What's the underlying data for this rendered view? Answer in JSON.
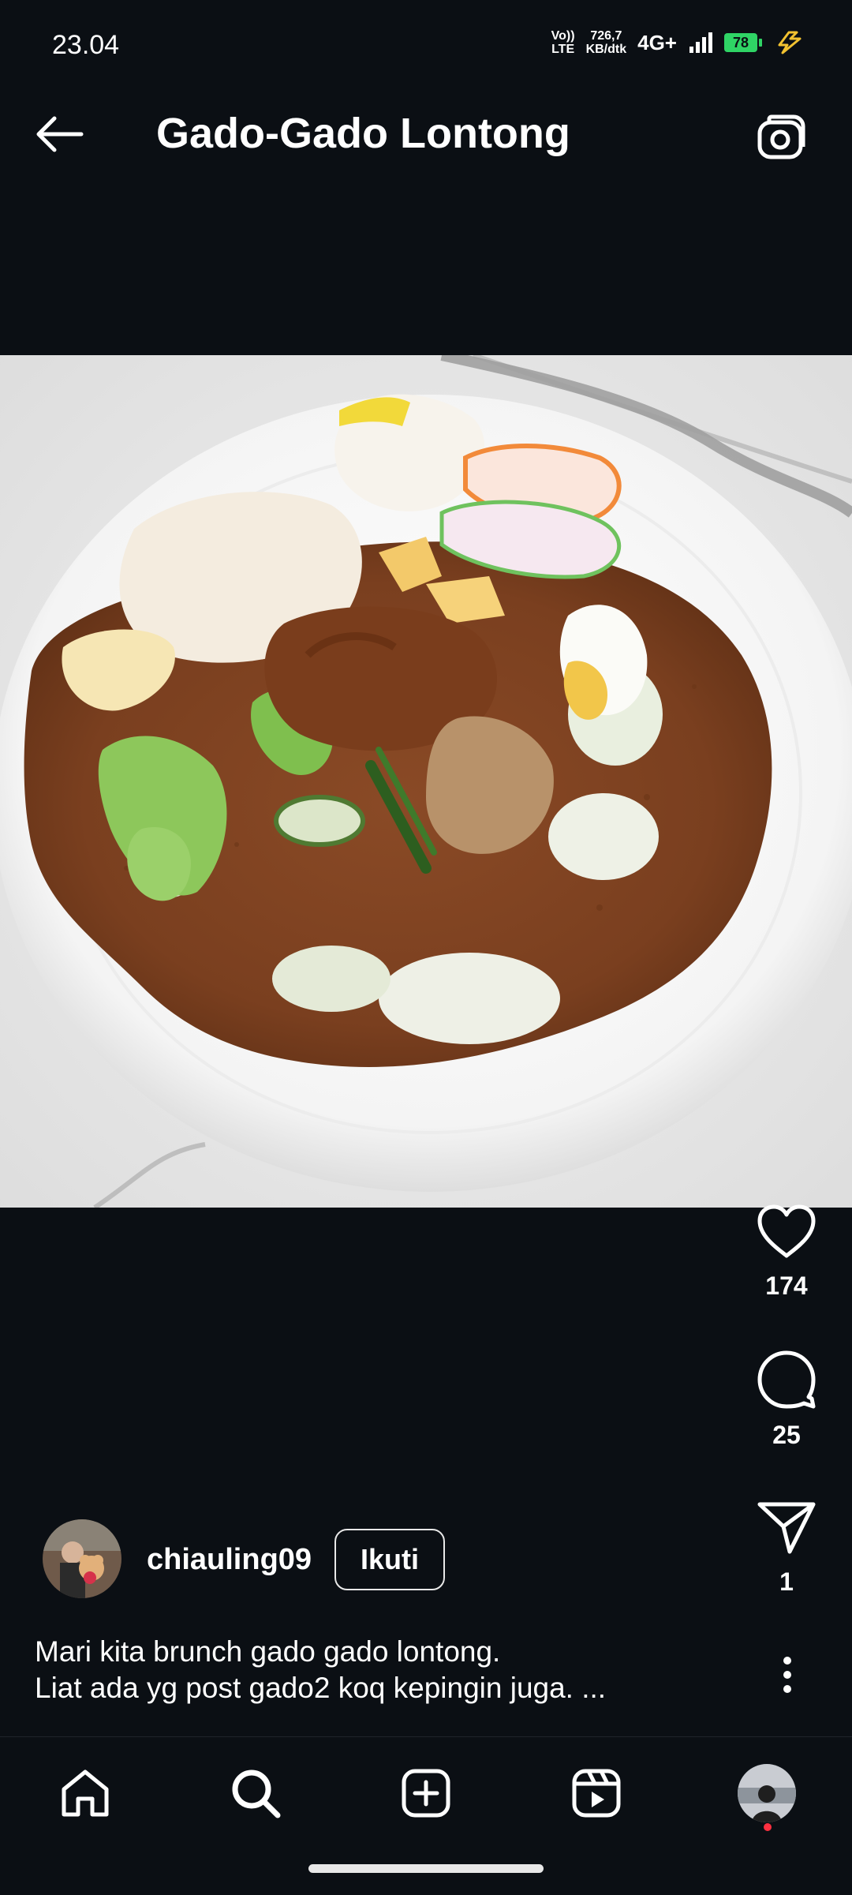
{
  "status_bar": {
    "time": "23.04",
    "volte_line1": "Vo))",
    "volte_line2": "LTE",
    "speed_value": "726,7",
    "speed_unit": "KB/dtk",
    "network": "4G+",
    "battery_level": "78",
    "battery_color": "#2fd465",
    "charging_color": "#f2c230"
  },
  "header": {
    "title": "Gado-Gado Lontong",
    "back_icon": "arrow-left-icon",
    "camera_icon": "camera-icon"
  },
  "post": {
    "likes": "174",
    "comments": "25",
    "shares": "1",
    "author": {
      "username": "chiauling09",
      "follow_label": "Ikuti"
    },
    "caption_line1": "Mari kita brunch gado gado lontong.",
    "caption_line2": "Liat ada yg post gado2 koq kepingin juga. ..."
  },
  "bottom_nav": {
    "items": [
      "home-icon",
      "search-icon",
      "create-icon",
      "reels-icon",
      "profile-avatar"
    ],
    "notification_color": "#ff3040"
  }
}
